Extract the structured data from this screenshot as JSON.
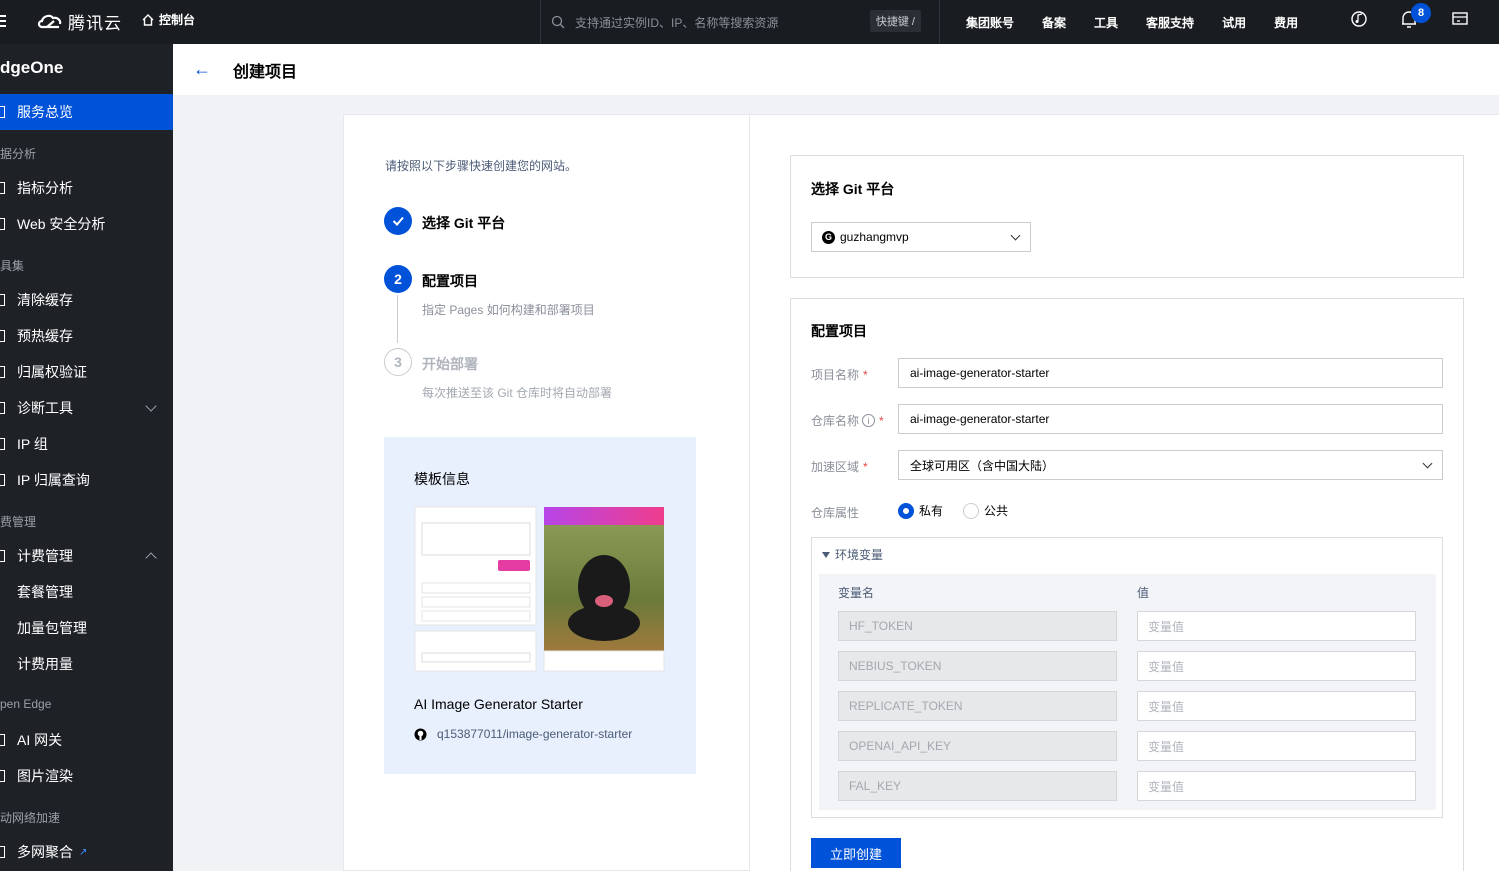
{
  "topbar": {
    "logo_text": "腾讯云",
    "console_label": "控制台",
    "search_placeholder": "支持通过实例ID、IP、名称等搜索资源",
    "shortcut_label": "快捷键 /",
    "nav": [
      "集团账号",
      "备案",
      "工具",
      "客服支持",
      "试用",
      "费用"
    ],
    "notification_count": "8"
  },
  "sidebar": {
    "product": "dgeOne",
    "items": [
      {
        "label": "服务总览",
        "active": true
      },
      {
        "group": "据分析"
      },
      {
        "label": "指标分析"
      },
      {
        "label": "Web 安全分析"
      },
      {
        "group": "具集"
      },
      {
        "label": "清除缓存"
      },
      {
        "label": "预热缓存"
      },
      {
        "label": "归属权验证"
      },
      {
        "label": "诊断工具"
      },
      {
        "label": "IP 组"
      },
      {
        "label": "IP 归属查询"
      },
      {
        "group": "费管理"
      },
      {
        "label": "计费管理"
      },
      {
        "label": "套餐管理"
      },
      {
        "label": "加量包管理"
      },
      {
        "label": "计费用量"
      },
      {
        "group": "pen Edge"
      },
      {
        "label": "AI 网关"
      },
      {
        "label": "图片渲染"
      },
      {
        "group": "动网络加速"
      },
      {
        "label": "多网聚合"
      }
    ]
  },
  "page": {
    "title": "创建项目"
  },
  "steps": {
    "intro": "请按照以下步骤快速创建您的网站。",
    "list": [
      {
        "num": "",
        "title": "选择 Git 平台",
        "desc": ""
      },
      {
        "num": "2",
        "title": "配置项目",
        "desc": "指定 Pages 如何构建和部署项目"
      },
      {
        "num": "3",
        "title": "开始部署",
        "desc": "每次推送至该 Git 仓库时将自动部署"
      }
    ]
  },
  "template": {
    "heading": "模板信息",
    "name": "AI Image Generator Starter",
    "repo": "q153877011/image-generator-starter"
  },
  "git_card": {
    "title": "选择 Git 平台",
    "account": "guzhangmvp"
  },
  "config": {
    "title": "配置项目",
    "project_name_label": "项目名称",
    "project_name": "ai-image-generator-starter",
    "repo_name_label": "仓库名称",
    "repo_name": "ai-image-generator-starter",
    "region_label": "加速区域",
    "region": "全球可用区（含中国大陆）",
    "repo_attr_label": "仓库属性",
    "private_label": "私有",
    "public_label": "公共",
    "env": {
      "toggle_label": "环境变量",
      "key_header": "变量名",
      "value_header": "值",
      "value_placeholder": "变量值",
      "keys": [
        "HF_TOKEN",
        "NEBIUS_TOKEN",
        "REPLICATE_TOKEN",
        "OPENAI_API_KEY",
        "FAL_KEY"
      ]
    },
    "create_button": "立即创建"
  },
  "colors": {
    "primary": "#0052d9",
    "topbar": "#191c20",
    "sidebar": "#1e2227"
  }
}
